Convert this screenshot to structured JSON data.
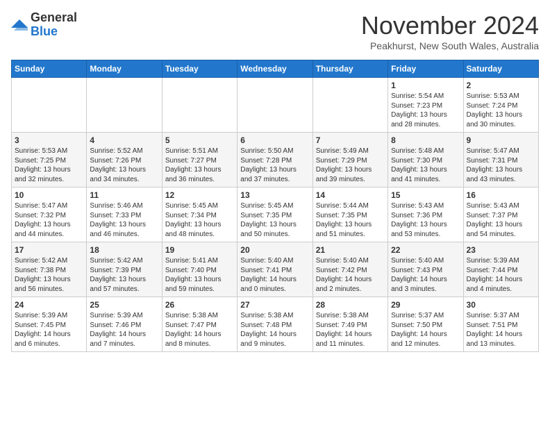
{
  "logo": {
    "general": "General",
    "blue": "Blue"
  },
  "title": "November 2024",
  "subtitle": "Peakhurst, New South Wales, Australia",
  "headers": [
    "Sunday",
    "Monday",
    "Tuesday",
    "Wednesday",
    "Thursday",
    "Friday",
    "Saturday"
  ],
  "weeks": [
    [
      {
        "day": "",
        "info": ""
      },
      {
        "day": "",
        "info": ""
      },
      {
        "day": "",
        "info": ""
      },
      {
        "day": "",
        "info": ""
      },
      {
        "day": "",
        "info": ""
      },
      {
        "day": "1",
        "info": "Sunrise: 5:54 AM\nSunset: 7:23 PM\nDaylight: 13 hours and 28 minutes."
      },
      {
        "day": "2",
        "info": "Sunrise: 5:53 AM\nSunset: 7:24 PM\nDaylight: 13 hours and 30 minutes."
      }
    ],
    [
      {
        "day": "3",
        "info": "Sunrise: 5:53 AM\nSunset: 7:25 PM\nDaylight: 13 hours and 32 minutes."
      },
      {
        "day": "4",
        "info": "Sunrise: 5:52 AM\nSunset: 7:26 PM\nDaylight: 13 hours and 34 minutes."
      },
      {
        "day": "5",
        "info": "Sunrise: 5:51 AM\nSunset: 7:27 PM\nDaylight: 13 hours and 36 minutes."
      },
      {
        "day": "6",
        "info": "Sunrise: 5:50 AM\nSunset: 7:28 PM\nDaylight: 13 hours and 37 minutes."
      },
      {
        "day": "7",
        "info": "Sunrise: 5:49 AM\nSunset: 7:29 PM\nDaylight: 13 hours and 39 minutes."
      },
      {
        "day": "8",
        "info": "Sunrise: 5:48 AM\nSunset: 7:30 PM\nDaylight: 13 hours and 41 minutes."
      },
      {
        "day": "9",
        "info": "Sunrise: 5:47 AM\nSunset: 7:31 PM\nDaylight: 13 hours and 43 minutes."
      }
    ],
    [
      {
        "day": "10",
        "info": "Sunrise: 5:47 AM\nSunset: 7:32 PM\nDaylight: 13 hours and 44 minutes."
      },
      {
        "day": "11",
        "info": "Sunrise: 5:46 AM\nSunset: 7:33 PM\nDaylight: 13 hours and 46 minutes."
      },
      {
        "day": "12",
        "info": "Sunrise: 5:45 AM\nSunset: 7:34 PM\nDaylight: 13 hours and 48 minutes."
      },
      {
        "day": "13",
        "info": "Sunrise: 5:45 AM\nSunset: 7:35 PM\nDaylight: 13 hours and 50 minutes."
      },
      {
        "day": "14",
        "info": "Sunrise: 5:44 AM\nSunset: 7:35 PM\nDaylight: 13 hours and 51 minutes."
      },
      {
        "day": "15",
        "info": "Sunrise: 5:43 AM\nSunset: 7:36 PM\nDaylight: 13 hours and 53 minutes."
      },
      {
        "day": "16",
        "info": "Sunrise: 5:43 AM\nSunset: 7:37 PM\nDaylight: 13 hours and 54 minutes."
      }
    ],
    [
      {
        "day": "17",
        "info": "Sunrise: 5:42 AM\nSunset: 7:38 PM\nDaylight: 13 hours and 56 minutes."
      },
      {
        "day": "18",
        "info": "Sunrise: 5:42 AM\nSunset: 7:39 PM\nDaylight: 13 hours and 57 minutes."
      },
      {
        "day": "19",
        "info": "Sunrise: 5:41 AM\nSunset: 7:40 PM\nDaylight: 13 hours and 59 minutes."
      },
      {
        "day": "20",
        "info": "Sunrise: 5:40 AM\nSunset: 7:41 PM\nDaylight: 14 hours and 0 minutes."
      },
      {
        "day": "21",
        "info": "Sunrise: 5:40 AM\nSunset: 7:42 PM\nDaylight: 14 hours and 2 minutes."
      },
      {
        "day": "22",
        "info": "Sunrise: 5:40 AM\nSunset: 7:43 PM\nDaylight: 14 hours and 3 minutes."
      },
      {
        "day": "23",
        "info": "Sunrise: 5:39 AM\nSunset: 7:44 PM\nDaylight: 14 hours and 4 minutes."
      }
    ],
    [
      {
        "day": "24",
        "info": "Sunrise: 5:39 AM\nSunset: 7:45 PM\nDaylight: 14 hours and 6 minutes."
      },
      {
        "day": "25",
        "info": "Sunrise: 5:39 AM\nSunset: 7:46 PM\nDaylight: 14 hours and 7 minutes."
      },
      {
        "day": "26",
        "info": "Sunrise: 5:38 AM\nSunset: 7:47 PM\nDaylight: 14 hours and 8 minutes."
      },
      {
        "day": "27",
        "info": "Sunrise: 5:38 AM\nSunset: 7:48 PM\nDaylight: 14 hours and 9 minutes."
      },
      {
        "day": "28",
        "info": "Sunrise: 5:38 AM\nSunset: 7:49 PM\nDaylight: 14 hours and 11 minutes."
      },
      {
        "day": "29",
        "info": "Sunrise: 5:37 AM\nSunset: 7:50 PM\nDaylight: 14 hours and 12 minutes."
      },
      {
        "day": "30",
        "info": "Sunrise: 5:37 AM\nSunset: 7:51 PM\nDaylight: 14 hours and 13 minutes."
      }
    ]
  ]
}
